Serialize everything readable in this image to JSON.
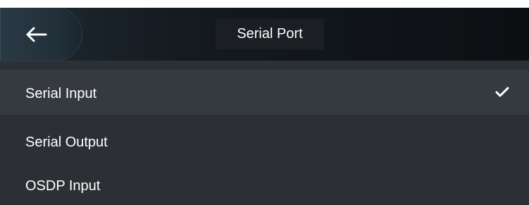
{
  "header": {
    "title": "Serial Port",
    "back_icon": "back-arrow-icon"
  },
  "menu": {
    "items": [
      {
        "label": "Serial Input",
        "selected": true
      },
      {
        "label": "Serial Output",
        "selected": false
      },
      {
        "label": "OSDP Input",
        "selected": false
      }
    ]
  },
  "colors": {
    "background": "#2c3035",
    "selected_row": "#353a40",
    "text": "#ffffff"
  }
}
